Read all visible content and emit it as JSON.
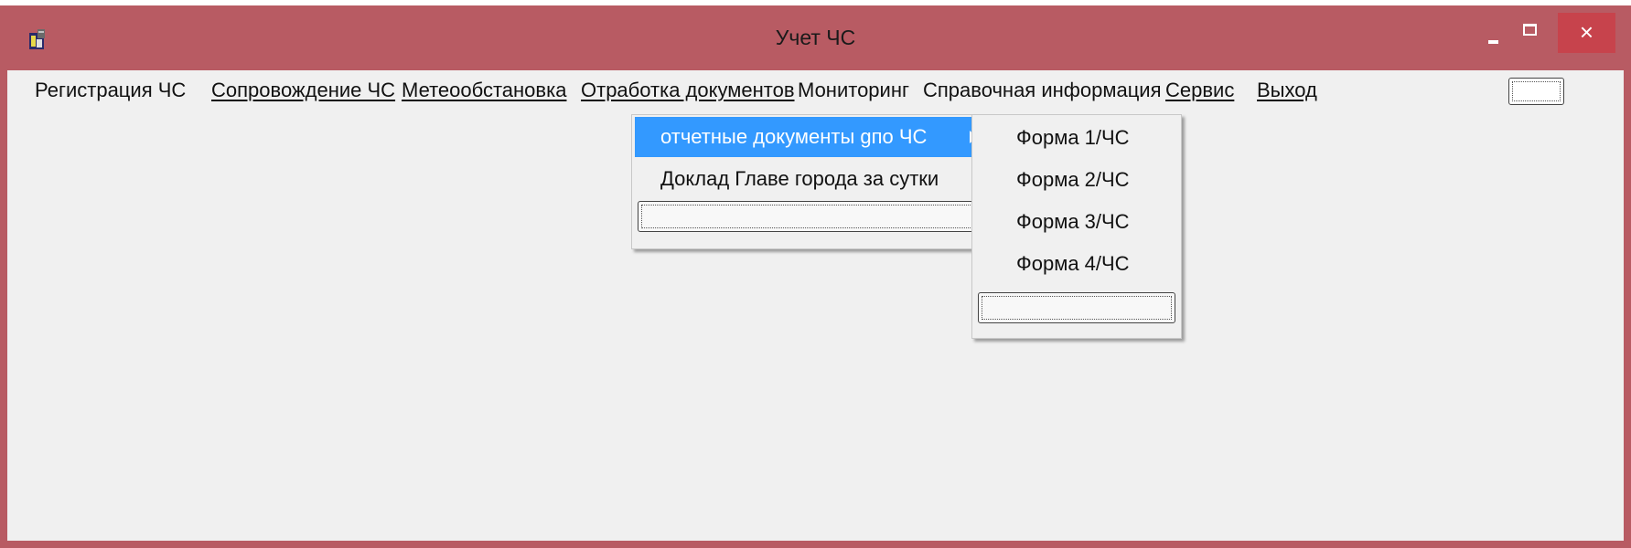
{
  "window": {
    "title": "Учет ЧС",
    "close_glyph": "×"
  },
  "menubar": {
    "items": [
      {
        "label": "Регистрация ЧС"
      },
      {
        "label": "Сопровождение ЧС"
      },
      {
        "label": "Метеообстановка"
      },
      {
        "label": "Отработка документов"
      },
      {
        "label": "Мониторинг"
      },
      {
        "label": "Справочная информация"
      },
      {
        "label": "Сервис"
      },
      {
        "label": "Выход"
      }
    ]
  },
  "dropdown": {
    "items": [
      {
        "label": "отчетные документы gпо ЧС",
        "highlighted": true,
        "has_submenu": true
      },
      {
        "label": "Доклад Главе города за сутки"
      }
    ]
  },
  "submenu": {
    "items": [
      {
        "label": "Форма 1/ЧС"
      },
      {
        "label": "Форма 2/ЧС"
      },
      {
        "label": "Форма 3/ЧС"
      },
      {
        "label": "Форма 4/ЧС"
      }
    ]
  },
  "colors": {
    "titlebar": "#b85b63",
    "close_button": "#c7434c",
    "client_bg": "#f0f0f0",
    "highlight": "#3399ff"
  },
  "icons": {
    "app": "app-icon",
    "minimize": "minimize-icon",
    "maximize": "maximize-icon",
    "close": "close-icon",
    "submenu_arrow": "chevron-right-icon"
  }
}
